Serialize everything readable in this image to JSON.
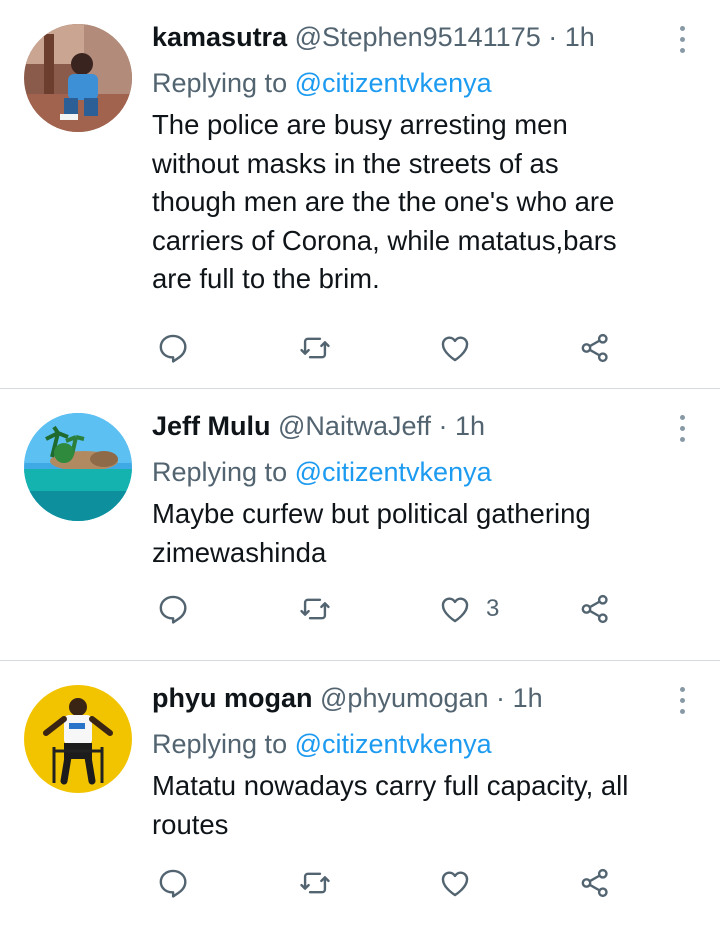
{
  "colors": {
    "mention": "#1d9bf0",
    "secondary_text": "#536471",
    "primary_text": "#0f1419",
    "icon": "#536471",
    "divider": "#d5dbe0"
  },
  "icons": {
    "reply": "reply-icon",
    "retweet": "retweet-icon",
    "like": "heart-icon",
    "share": "share-icon",
    "more": "more-options-icon"
  },
  "tweets": [
    {
      "display_name": "kamasutra",
      "handle": "@Stephen95141175",
      "separator": "·",
      "time": "1h",
      "replying_prefix": "Replying to",
      "replying_to": "@citizentvkenya",
      "text": "The police are busy arresting men\nwithout masks in the streets of as\nthough men are the the one's who are\ncarriers of Corona, while matatus,bars\nare full to the brim.",
      "like_count": ""
    },
    {
      "display_name": "Jeff Mulu",
      "handle": "@NaitwaJeff",
      "separator": "·",
      "time": "1h",
      "replying_prefix": "Replying to",
      "replying_to": "@citizentvkenya",
      "text": "Maybe curfew but political gathering\nzimewashinda",
      "like_count": "3"
    },
    {
      "display_name": "phyu mogan",
      "handle": "@phyumogan",
      "separator": "·",
      "time": "1h",
      "replying_prefix": "Replying to",
      "replying_to": "@citizentvkenya",
      "text": "Matatu nowadays carry full capacity, all\nroutes",
      "like_count": ""
    }
  ]
}
